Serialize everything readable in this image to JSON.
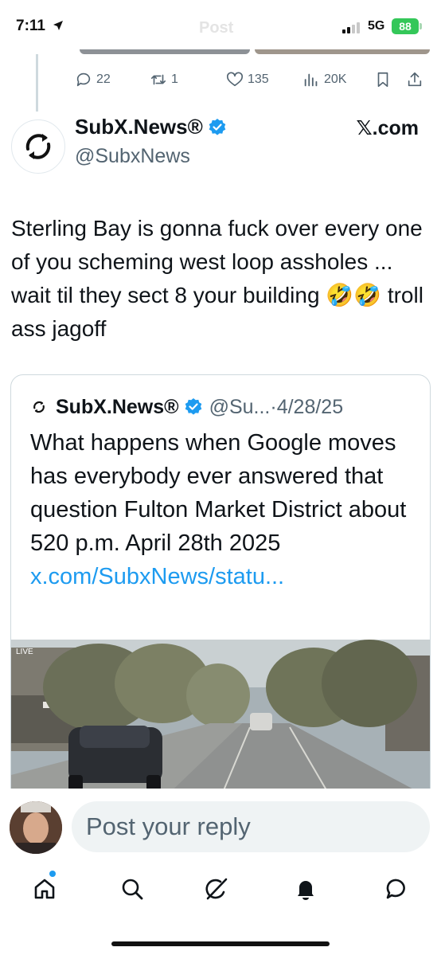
{
  "status_bar": {
    "time": "7:11",
    "ghost_title": "Post",
    "network": "5G",
    "battery": "88"
  },
  "actions": {
    "replies": "22",
    "reposts": "1",
    "likes": "135",
    "views": "20K"
  },
  "tweet": {
    "display_name": "SubX.News®",
    "handle": "@SubxNews",
    "source": "𝕏.com",
    "text": "Sterling Bay is gonna fuck over every one of you scheming west loop assholes ... wait til they sect 8 your building 🤣🤣 troll ass jagoff"
  },
  "quote": {
    "display_name": "SubX.News®",
    "handle": "@Su...",
    "date": "·4/28/25",
    "text": "What happens when Google moves has everybody ever answered that question Fulton Market District about 520 p.m. April 28th 2025 ",
    "link": "x.com/SubxNews/statu...",
    "media_sign": "LIVE"
  },
  "reply": {
    "placeholder": "Post your reply"
  },
  "nav": {
    "items": [
      "home",
      "search",
      "grok",
      "notifications",
      "messages"
    ]
  },
  "colors": {
    "accent": "#1d9bf0",
    "text": "#0f1419",
    "secondary": "#536471",
    "border": "#cfd9de",
    "battery": "#34c759"
  }
}
